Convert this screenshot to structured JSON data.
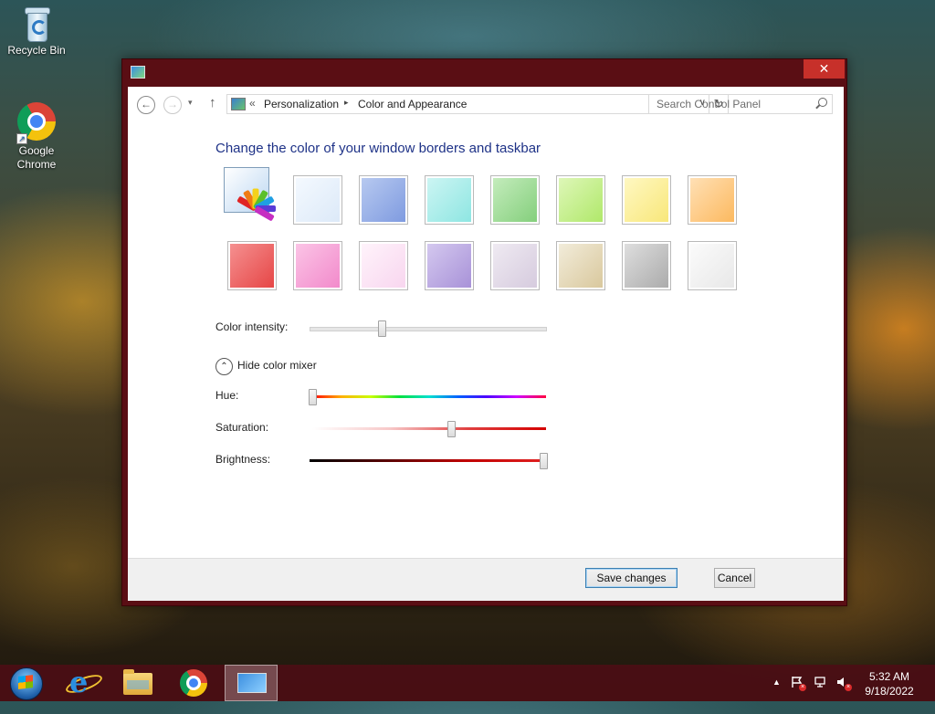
{
  "desktop": {
    "icons": [
      {
        "label": "Recycle Bin",
        "icon": "recycle-bin-icon"
      },
      {
        "label": "Google Chrome",
        "icon": "chrome-icon"
      }
    ]
  },
  "window": {
    "close_glyph": "✕",
    "nav": {
      "back_glyph": "←",
      "forward_glyph": "→",
      "up_glyph": "↑",
      "recent_glyph": "▾",
      "refresh_glyph": "↻",
      "dropdown_glyph": "∨"
    },
    "breadcrumb": {
      "prefix": "«",
      "items": [
        "Personalization",
        "Color and Appearance"
      ],
      "separator": "▸"
    },
    "search": {
      "placeholder": "Search Control Panel"
    },
    "heading": "Change the color of your window borders and taskbar",
    "swatches_row1": [
      "#dce9f8",
      "#8ea9e6",
      "#a8ecea",
      "#9ed898",
      "#c3ee8a",
      "#fbef95",
      "#fdc98a"
    ],
    "swatches_row2": [
      "#ee6464",
      "#f7a3d5",
      "#fbe2f4",
      "#bcaae3",
      "#e2dbe8",
      "#e6dcbf",
      "#c9c9c9",
      "#f2f2f2"
    ],
    "selected_swatch": "automatic",
    "intensity": {
      "label": "Color intensity:",
      "value": 0.3
    },
    "mixer_toggle": {
      "label": "Hide color mixer",
      "glyph": "⌃"
    },
    "sliders": [
      {
        "label": "Hue:",
        "value": 0.0
      },
      {
        "label": "Saturation:",
        "value": 0.6
      },
      {
        "label": "Brightness:",
        "value": 1.0
      }
    ],
    "buttons": {
      "save": "Save changes",
      "cancel": "Cancel"
    }
  },
  "taskbar": {
    "pinned": [
      "start-icon",
      "internet-explorer-icon",
      "file-explorer-icon",
      "chrome-icon",
      "control-panel-icon"
    ],
    "active": "control-panel-icon",
    "tray": {
      "overflow_glyph": "▲",
      "time": "5:32 AM",
      "date": "9/18/2022"
    }
  },
  "colors": {
    "accent": "#5a0e14",
    "heading": "#1e3287",
    "close": "#c7302a"
  }
}
